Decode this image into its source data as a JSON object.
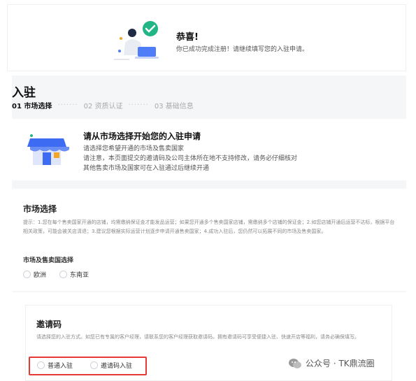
{
  "banner": {
    "title": "恭喜!",
    "subtitle": "你已成功完成注册！请继续填写您的入驻申请。"
  },
  "page": {
    "title": "入驻",
    "steps": [
      {
        "label": "01 市场选择"
      },
      {
        "label": "02 资质认证"
      },
      {
        "label": "03 基础信息"
      }
    ],
    "step_separator": "·······"
  },
  "intro": {
    "title": "请从市场选择开始您的入驻申请",
    "lines": [
      "请选择您希望开通的市场及售卖国家",
      "请注意，本页面提交的邀请码及公司主体所在地不支持修改，请务必仔细核对",
      "其他售卖市场及国家可在入驻通过后继续开通"
    ]
  },
  "market": {
    "title": "市场选择",
    "tip": "提示：1.您在每个售卖国家开通的店铺，均需缴纳保证金才能发品运营；如果您开通多个售卖国家店铺，需缴纳多个店铺的保证金；2.如您店铺开通后运营不达标，根据平台相关政策，可能会被关店清退；3.建议您根据实际运营计划逐步申请开通售卖国家；4.成功入驻后，您仍然可以拓展不同的市场及售卖国家。",
    "region_label": "市场及售卖国选择",
    "options": [
      "欧洲",
      "东南亚"
    ]
  },
  "invite": {
    "title": "邀请码",
    "tip": "请选择您的入驻方式。如您已有专属的客户经理，请联系您的客户经理获取邀请码。拥有邀请码可享受便捷入驻、快速开店等福利，请务必确保填写。",
    "options": [
      "普通入驻",
      "邀请码入驻"
    ]
  },
  "watermark": {
    "text": "公众号 · TK鼎流圈"
  },
  "colors": {
    "accent_green": "#22b585",
    "highlight_red": "#e53935",
    "store_blue": "#3d6bf2"
  }
}
